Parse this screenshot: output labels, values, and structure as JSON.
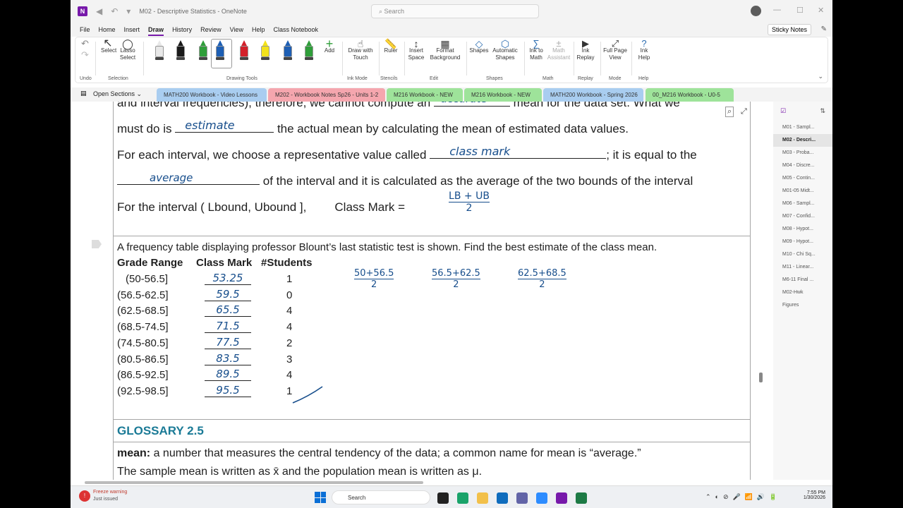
{
  "window": {
    "title": "M02 - Descriptive Statistics - OneNote",
    "search_placeholder": "Search",
    "logo": "N"
  },
  "menu": [
    "File",
    "Home",
    "Insert",
    "Draw",
    "History",
    "Review",
    "View",
    "Help",
    "Class Notebook"
  ],
  "menu_active": "Draw",
  "sticky_notes": "Sticky Notes",
  "ribbon": {
    "select": "Select",
    "lasso": "Lasso\nSelect",
    "undo_group": "Undo",
    "selection_group": "Selection",
    "drawing_tools_group": "Drawing Tools",
    "add": "Add",
    "draw_touch": "Draw with\nTouch",
    "ink_mode_group": "Ink Mode",
    "ruler": "Ruler",
    "stencils_group": "Stencils",
    "insert_space": "Insert\nSpace",
    "format_bg": "Format\nBackground",
    "edit_group": "Edit",
    "shapes": "Shapes",
    "auto_shapes": "Automatic\nShapes",
    "shapes_group": "Shapes",
    "ink_math": "Ink to\nMath",
    "math_assist": "Math\nAssistant",
    "math_group": "Math",
    "ink_replay": "Ink\nReplay",
    "replay_group": "Replay",
    "full_page": "Full Page\nView",
    "mode_group": "Mode",
    "ink_help": "Ink\nHelp",
    "help_group": "Help"
  },
  "pen_colors": [
    "#e8e8e8",
    "#1a1a1a",
    "#2f9e3a",
    "#1e5fb4",
    "#d2202a",
    "#f3e21a",
    "#1e5fb4",
    "#2f9e3a"
  ],
  "open_sections": "Open Sections",
  "section_tabs": [
    {
      "label": "MATH200 Workbook - Video Lessons",
      "color": "#a9cdf0"
    },
    {
      "label": "M202 - Workbook Notes Sp26 - Units 1-2",
      "color": "#f5a6ae"
    },
    {
      "label": "M216 Workbook - NEW",
      "color": "#9ee39a"
    },
    {
      "label": "M216 Workbook - NEW",
      "color": "#9ee39a"
    },
    {
      "label": "MATH200 Workbook - Spring 2026",
      "color": "#a9cdf0"
    },
    {
      "label": "00_M216 Workbook - U0-5",
      "color": "#9ee39a"
    }
  ],
  "content": {
    "top_cut": "and interval frequencies), therefore, we cannot compute an",
    "top_cut_hw": "accurate",
    "top_cut_tail": "mean for the data set. What we",
    "line1_pre": "must do is",
    "line1_hw": "estimate",
    "line1_post": "the actual mean by calculating the mean of estimated data values.",
    "line2_pre": "For each interval, we choose a representative value called",
    "line2_hw": "class mark",
    "line2_post": "; it is equal to the",
    "line3_hw": "average",
    "line3_post": "of the interval and it is calculated as the average of the two bounds of the interval",
    "line4_a": "For the interval  ( Lbound, Ubound ],",
    "line4_b": "Class Mark =",
    "line4_num": "LB + UB",
    "line4_den": "2",
    "problem": "A frequency table displaying professor Blount’s last statistic test is shown. Find the best estimate of the class mean.",
    "headers": [
      "Grade Range",
      "Class Mark",
      "#Students"
    ],
    "rows": [
      {
        "range": "(50-56.5]",
        "mark": "53.25",
        "n": "1"
      },
      {
        "range": "(56.5-62.5]",
        "mark": "59.5",
        "n": "0"
      },
      {
        "range": "(62.5-68.5]",
        "mark": "65.5",
        "n": "4"
      },
      {
        "range": "(68.5-74.5]",
        "mark": "71.5",
        "n": "4"
      },
      {
        "range": "(74.5-80.5]",
        "mark": "77.5",
        "n": "2"
      },
      {
        "range": "(80.5-86.5]",
        "mark": "83.5",
        "n": "3"
      },
      {
        "range": "(86.5-92.5]",
        "mark": "89.5",
        "n": "4"
      },
      {
        "range": "(92.5-98.5]",
        "mark": "95.5",
        "n": "1"
      }
    ],
    "fractions": [
      {
        "num": "50+56.5",
        "den": "2"
      },
      {
        "num": "56.5+62.5",
        "den": "2"
      },
      {
        "num": "62.5+68.5",
        "den": "2"
      }
    ],
    "glossary": "GLOSSARY 2.5",
    "mean_term": "mean:",
    "mean_def": " a number that measures the central tendency of the data; a common name for mean is “average.”",
    "mean_line2": "The sample mean is written as x̄ and the population mean is written as μ."
  },
  "pages": [
    "M01 - Sampl...",
    "M02 - Descri...",
    "M03 - Proba...",
    "M04 - Discre...",
    "M05 - Contin...",
    "M01-05 Midt...",
    "M06 - Sampl...",
    "M07 - Confid...",
    "M08 - Hypot...",
    "M09 - Hypot...",
    "M10 - Chi Sq...",
    "M11 - Linear...",
    "M6-11 Final ...",
    "M02-Hwk",
    "Figures"
  ],
  "pages_selected": 1,
  "taskbar": {
    "weather_title": "Freeze warning",
    "weather_sub": "Just issued",
    "search": "Search",
    "time": "7:55 PM",
    "date": "1/30/2026"
  }
}
